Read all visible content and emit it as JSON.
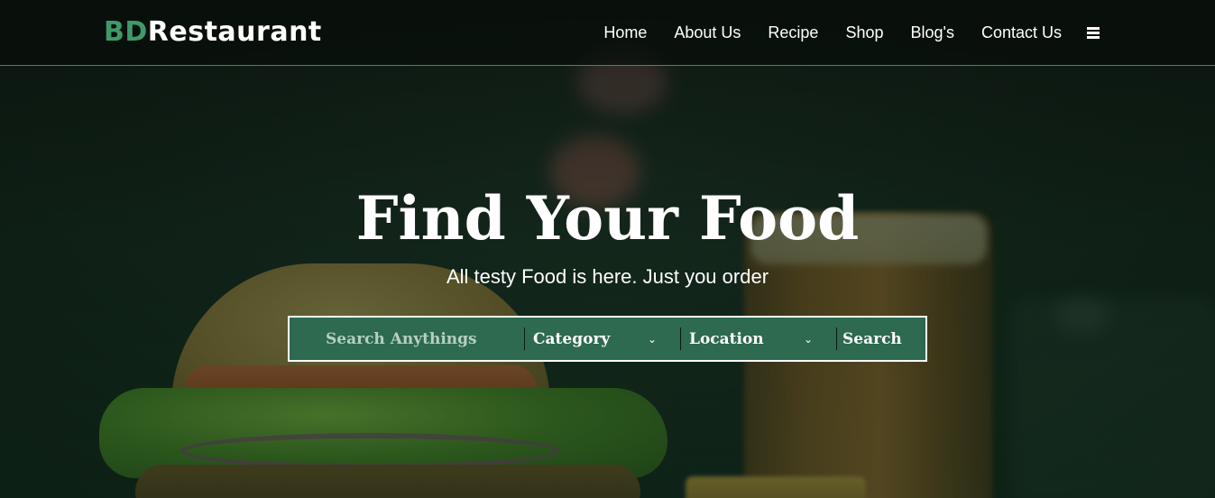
{
  "header": {
    "logo": {
      "accent": "BD",
      "rest": "Restaurant"
    },
    "nav": [
      "Home",
      "About Us",
      "Recipe",
      "Shop",
      "Blog's",
      "Contact Us"
    ],
    "menu_icon": "hamburger-menu-icon"
  },
  "hero": {
    "title": "Find Your Food",
    "subtitle": "All testy Food is here. Just you order"
  },
  "search": {
    "placeholder": "Search Anythings",
    "category_label": "Category",
    "location_label": "Location",
    "button_label": "Search",
    "dropdown_icon": "chevron-down-icon"
  },
  "colors": {
    "brand_green": "#3f9a6a",
    "search_bar_bg": "#2d6a4f",
    "header_border": "#3f8a62"
  }
}
